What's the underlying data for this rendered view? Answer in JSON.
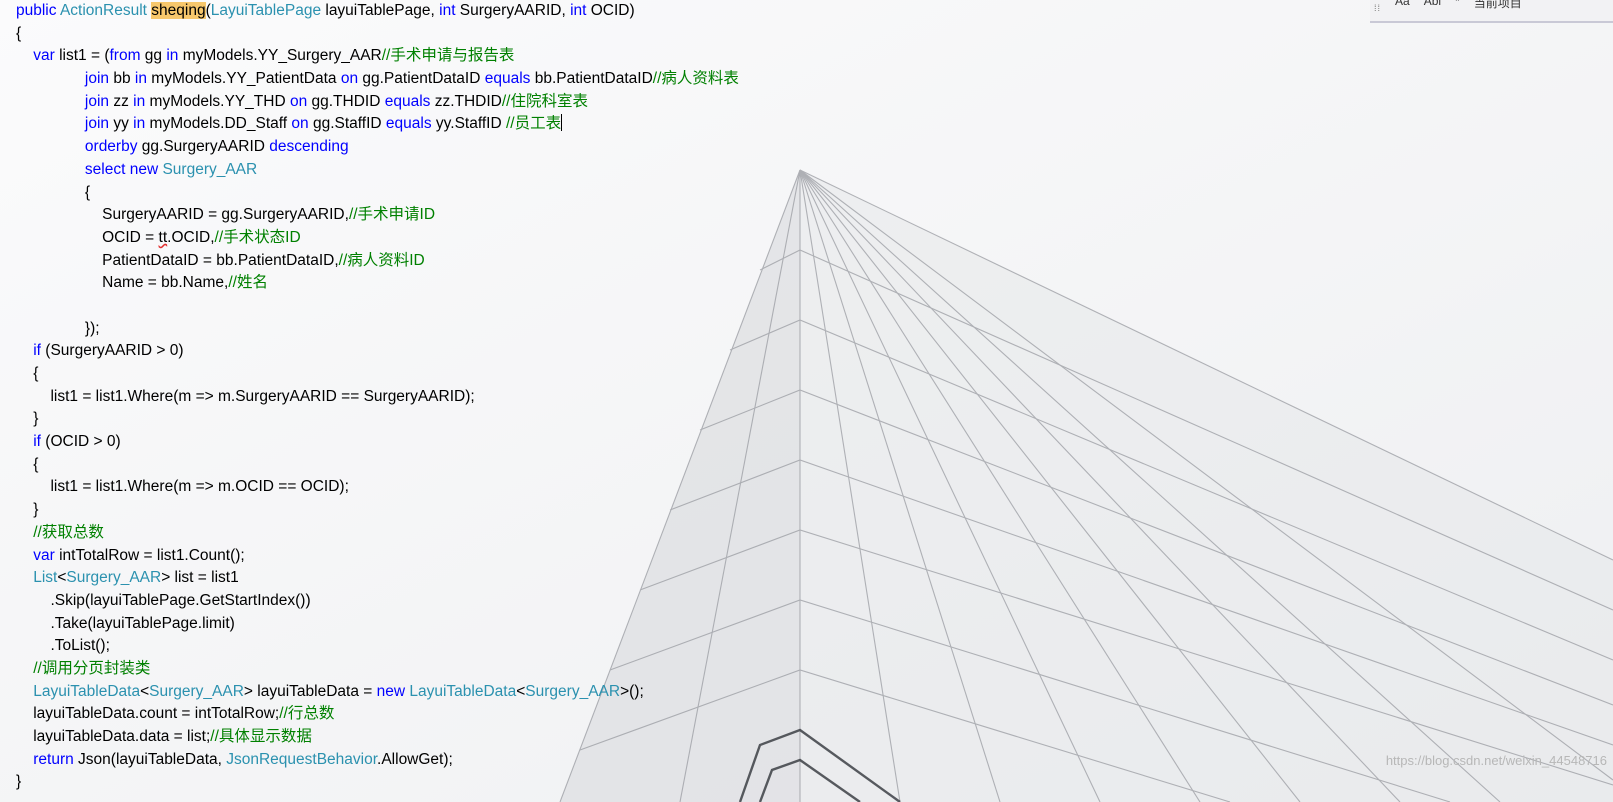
{
  "toolbar": {
    "match_case": "Aa",
    "whole_word": "Abl",
    "regex": "*",
    "scope": "当前项目"
  },
  "watermark": "https://blog.csdn.net/weixin_44548716",
  "code_lines": [
    [
      [
        "kw",
        "public "
      ],
      [
        "ty",
        "ActionResult "
      ],
      [
        "hl",
        "sheqing"
      ],
      [
        "",
        "("
      ],
      [
        "ty",
        "LayuiTablePage"
      ],
      [
        "",
        " layuiTablePage, "
      ],
      [
        "kw",
        "int"
      ],
      [
        "",
        " SurgeryAARID, "
      ],
      [
        "kw",
        "int"
      ],
      [
        "",
        " OCID)"
      ]
    ],
    [
      [
        "",
        "{"
      ]
    ],
    [
      [
        "",
        "    "
      ],
      [
        "kw",
        "var"
      ],
      [
        "",
        " list1 = ("
      ],
      [
        "kw",
        "from"
      ],
      [
        "",
        " gg "
      ],
      [
        "kw",
        "in"
      ],
      [
        "",
        " myModels.YY_Surgery_AAR"
      ],
      [
        "cm",
        "//手术申请与报告表"
      ]
    ],
    [
      [
        "",
        "                "
      ],
      [
        "kw",
        "join"
      ],
      [
        "",
        " bb "
      ],
      [
        "kw",
        "in"
      ],
      [
        "",
        " myModels.YY_PatientData "
      ],
      [
        "kw",
        "on"
      ],
      [
        "",
        " gg.PatientDataID "
      ],
      [
        "kw",
        "equals"
      ],
      [
        "",
        " bb.PatientDataID"
      ],
      [
        "cm",
        "//病人资料表"
      ]
    ],
    [
      [
        "",
        "                "
      ],
      [
        "kw",
        "join"
      ],
      [
        "",
        " zz "
      ],
      [
        "kw",
        "in"
      ],
      [
        "",
        " myModels.YY_THD "
      ],
      [
        "kw",
        "on"
      ],
      [
        "",
        " gg.THDID "
      ],
      [
        "kw",
        "equals"
      ],
      [
        "",
        " zz.THDID"
      ],
      [
        "cm",
        "//住院科室表"
      ]
    ],
    [
      [
        "",
        "                "
      ],
      [
        "kw",
        "join"
      ],
      [
        "",
        " yy "
      ],
      [
        "kw",
        "in"
      ],
      [
        "",
        " myModels.DD_Staff "
      ],
      [
        "kw",
        "on"
      ],
      [
        "",
        " gg.StaffID "
      ],
      [
        "kw",
        "equals"
      ],
      [
        "",
        " yy.StaffID "
      ],
      [
        "cm",
        "//员工表"
      ],
      [
        "caret",
        ""
      ]
    ],
    [
      [
        "",
        "                "
      ],
      [
        "kw",
        "orderby"
      ],
      [
        "",
        " gg.SurgeryAARID "
      ],
      [
        "kw",
        "descending"
      ]
    ],
    [
      [
        "",
        "                "
      ],
      [
        "kw",
        "select new "
      ],
      [
        "ty",
        "Surgery_AAR"
      ]
    ],
    [
      [
        "",
        "                {"
      ]
    ],
    [
      [
        "",
        "                    SurgeryAARID = gg.SurgeryAARID,"
      ],
      [
        "cm",
        "//手术申请ID"
      ]
    ],
    [
      [
        "",
        "                    OCID = "
      ],
      [
        "squig",
        "tt"
      ],
      [
        "",
        ".OCID,"
      ],
      [
        "cm",
        "//手术状态ID"
      ]
    ],
    [
      [
        "",
        "                    PatientDataID = bb.PatientDataID,"
      ],
      [
        "cm",
        "//病人资料ID"
      ]
    ],
    [
      [
        "",
        "                    Name = bb.Name,"
      ],
      [
        "cm",
        "//姓名"
      ]
    ],
    [
      [
        "",
        ""
      ]
    ],
    [
      [
        "",
        "                });"
      ]
    ],
    [
      [
        "",
        "    "
      ],
      [
        "kw",
        "if"
      ],
      [
        "",
        " (SurgeryAARID > 0)"
      ]
    ],
    [
      [
        "",
        "    {"
      ]
    ],
    [
      [
        "",
        "        list1 = list1.Where(m => m.SurgeryAARID == SurgeryAARID);"
      ]
    ],
    [
      [
        "",
        "    }"
      ]
    ],
    [
      [
        "",
        "    "
      ],
      [
        "kw",
        "if"
      ],
      [
        "",
        " (OCID > 0)"
      ]
    ],
    [
      [
        "",
        "    {"
      ]
    ],
    [
      [
        "",
        "        list1 = list1.Where(m => m.OCID == OCID);"
      ]
    ],
    [
      [
        "",
        "    }"
      ]
    ],
    [
      [
        "",
        "    "
      ],
      [
        "cm",
        "//获取总数"
      ]
    ],
    [
      [
        "",
        "    "
      ],
      [
        "kw",
        "var"
      ],
      [
        "",
        " intTotalRow = list1.Count();"
      ]
    ],
    [
      [
        "",
        "    "
      ],
      [
        "ty",
        "List"
      ],
      [
        "",
        "<"
      ],
      [
        "ty",
        "Surgery_AAR"
      ],
      [
        "",
        "> list = list1"
      ]
    ],
    [
      [
        "",
        "        .Skip(layuiTablePage.GetStartIndex())"
      ]
    ],
    [
      [
        "",
        "        .Take(layuiTablePage.limit)"
      ]
    ],
    [
      [
        "",
        "        .ToList();"
      ]
    ],
    [
      [
        "",
        "    "
      ],
      [
        "cm",
        "//调用分页封装类"
      ]
    ],
    [
      [
        "",
        "    "
      ],
      [
        "ty",
        "LayuiTableData"
      ],
      [
        "",
        "<"
      ],
      [
        "ty",
        "Surgery_AAR"
      ],
      [
        "",
        "> layuiTableData = "
      ],
      [
        "kw",
        "new "
      ],
      [
        "ty",
        "LayuiTableData"
      ],
      [
        "",
        "<"
      ],
      [
        "ty",
        "Surgery_AAR"
      ],
      [
        "",
        ">();"
      ]
    ],
    [
      [
        "",
        "    layuiTableData.count = intTotalRow;"
      ],
      [
        "cm",
        "//行总数"
      ]
    ],
    [
      [
        "",
        "    layuiTableData.data = list;"
      ],
      [
        "cm",
        "//具体显示数据"
      ]
    ],
    [
      [
        "",
        "    "
      ],
      [
        "kw",
        "return"
      ],
      [
        "",
        " Json(layuiTableData, "
      ],
      [
        "ty",
        "JsonRequestBehavior"
      ],
      [
        "",
        ".AllowGet);"
      ]
    ],
    [
      [
        "",
        "}"
      ]
    ]
  ]
}
